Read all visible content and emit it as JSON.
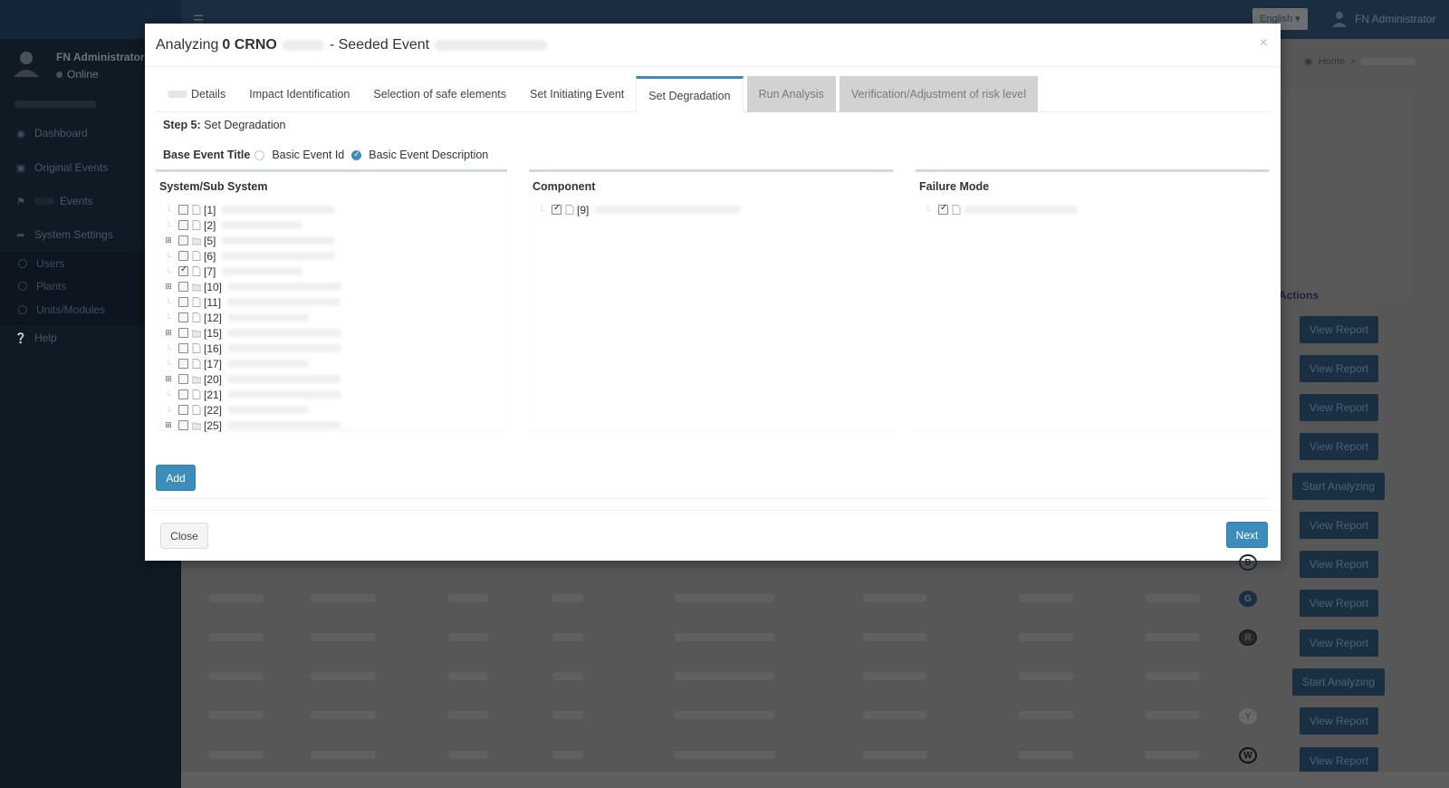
{
  "topbar": {
    "language": "English ▾",
    "user_name": "FN Administrator"
  },
  "sidebar": {
    "profile_name": "FN Administrator",
    "profile_status": "Online",
    "items": [
      {
        "label": "Dashboard",
        "icon": "dashboard-icon"
      },
      {
        "label": "Original Events",
        "icon": "inbox-icon"
      },
      {
        "label": "Events",
        "icon": "flag-icon"
      },
      {
        "label": "System Settings",
        "icon": "share-icon"
      }
    ],
    "sub_items": [
      {
        "label": "Users"
      },
      {
        "label": "Plants"
      },
      {
        "label": "Units/Modules"
      }
    ],
    "help": {
      "label": "Help",
      "icon": "question-icon"
    }
  },
  "background": {
    "breadcrumb_home": "Home",
    "breadcrumb_sep": ">",
    "actions_header": "Actions",
    "action_buttons": [
      "View Report",
      "View Report",
      "View Report",
      "View Report",
      "Start Analyzing",
      "View Report",
      "View Report",
      "View Report",
      "View Report",
      "Start Analyzing",
      "View Report",
      "View Report"
    ],
    "risk_badges": [
      "B",
      "G",
      "R",
      "",
      "Y",
      "W"
    ]
  },
  "modal": {
    "title_prefix": "Analyzing",
    "title_event_no": "0 CRNO",
    "title_mid": "- Seeded Event",
    "close_glyph": "×",
    "tabs": [
      {
        "label": "Details",
        "state": "normal"
      },
      {
        "label": "Impact Identification",
        "state": "normal"
      },
      {
        "label": "Selection of safe elements",
        "state": "normal"
      },
      {
        "label": "Set Initiating Event",
        "state": "normal"
      },
      {
        "label": "Set Degradation",
        "state": "active"
      },
      {
        "label": "Run Analysis",
        "state": "disabled"
      },
      {
        "label": "Verification/Adjustment of risk level",
        "state": "disabled"
      }
    ],
    "step_label": "Step 5:",
    "step_title": "Set Degradation",
    "base_event_title_label": "Base Event Title",
    "options": [
      {
        "label": "Basic Event Id",
        "checked": false
      },
      {
        "label": "Basic Event Description",
        "checked": true
      }
    ],
    "panels": {
      "system": {
        "title": "System/Sub System",
        "nodes": [
          {
            "id": "[1]",
            "type": "file",
            "expandable": false,
            "checked": false,
            "desc": "System_Title_1 System_Title_1"
          },
          {
            "id": "[2]",
            "type": "file",
            "expandable": false,
            "checked": false,
            "desc": "RCVC System_Title_2"
          },
          {
            "id": "[5]",
            "type": "folder",
            "expandable": true,
            "checked": false,
            "desc": "System_Title_2 System_Title_2"
          },
          {
            "id": "[6]",
            "type": "file",
            "expandable": false,
            "checked": false,
            "desc": "System_Title_1 System_Title_1"
          },
          {
            "id": "[7]",
            "type": "file",
            "expandable": false,
            "checked": true,
            "desc": "RCVC System_Title_2"
          },
          {
            "id": "[10]",
            "type": "folder",
            "expandable": true,
            "checked": false,
            "desc": "System_Title_2 System_Title_2"
          },
          {
            "id": "[11]",
            "type": "file",
            "expandable": false,
            "checked": false,
            "desc": "System_Title_1 System_Title_1"
          },
          {
            "id": "[12]",
            "type": "file",
            "expandable": false,
            "checked": false,
            "desc": "RCVC System_Title_2"
          },
          {
            "id": "[15]",
            "type": "folder",
            "expandable": true,
            "checked": false,
            "desc": "System_Title_2 System_Title_2"
          },
          {
            "id": "[16]",
            "type": "file",
            "expandable": false,
            "checked": false,
            "desc": "System_Title_1 System_Title_1"
          },
          {
            "id": "[17]",
            "type": "file",
            "expandable": false,
            "checked": false,
            "desc": "RCVC System_Title_2"
          },
          {
            "id": "[20]",
            "type": "folder",
            "expandable": true,
            "checked": false,
            "desc": "System_Title_2 System_Title_2"
          },
          {
            "id": "[21]",
            "type": "file",
            "expandable": false,
            "checked": false,
            "desc": "System_Title_1 System_Title_1"
          },
          {
            "id": "[22]",
            "type": "file",
            "expandable": false,
            "checked": false,
            "desc": "RCVC System_Title_2"
          },
          {
            "id": "[25]",
            "type": "folder",
            "expandable": true,
            "checked": false,
            "desc": "System_Title_2 System_Title_2"
          }
        ]
      },
      "component": {
        "title": "Component",
        "nodes": [
          {
            "id": "[9]",
            "type": "file",
            "expandable": false,
            "checked": true,
            "desc": "RCVC-999-111-TPC Component_Title_1"
          }
        ]
      },
      "failure": {
        "title": "Failure Mode",
        "nodes": [
          {
            "id": "",
            "type": "file",
            "expandable": false,
            "checked": true,
            "desc": "Basic_Element_Title_1-1-10-10"
          }
        ]
      }
    },
    "add_label": "Add",
    "close_label": "Close",
    "next_label": "Next"
  }
}
